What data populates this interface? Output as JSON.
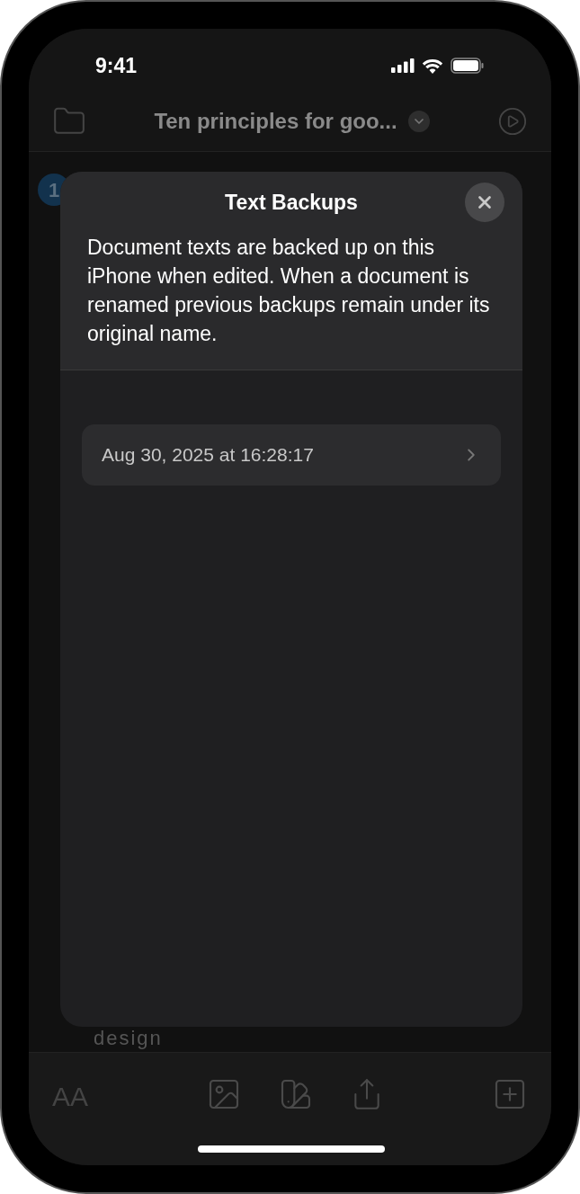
{
  "status_bar": {
    "time": "9:41"
  },
  "nav_bar": {
    "title": "Ten principles for goo..."
  },
  "document": {
    "badge": "1",
    "visible_text": "design"
  },
  "sheet": {
    "title": "Text Backups",
    "description": "Document texts are backed up on this iPhone when edited. When a document is renamed previous backups remain under its original name.",
    "backups": [
      {
        "label": "Aug 30, 2025 at 16:28:17"
      }
    ]
  },
  "toolbar": {
    "font_button": "AA"
  }
}
